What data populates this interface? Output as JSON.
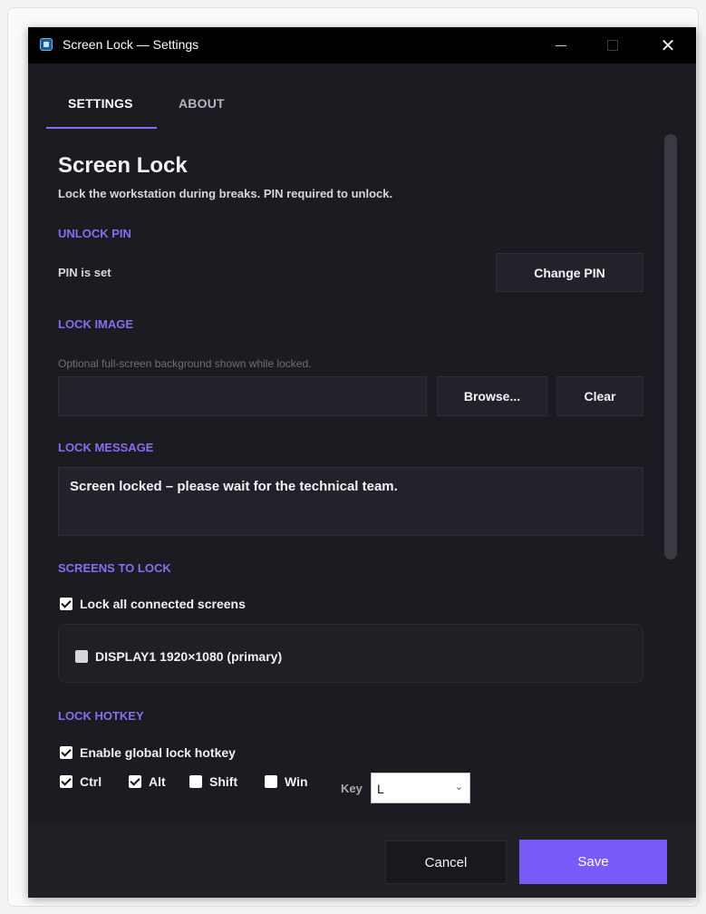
{
  "window": {
    "title": "Screen Lock — Settings"
  },
  "tabs": [
    {
      "label": "SETTINGS",
      "active": true
    },
    {
      "label": "ABOUT",
      "active": false
    }
  ],
  "page": {
    "heading": "Screen Lock",
    "subtitle": "Lock the workstation during breaks. PIN required to unlock."
  },
  "unlock_pin": {
    "section_label": "UNLOCK PIN",
    "status": "PIN is set",
    "change_button": "Change PIN"
  },
  "lock_image": {
    "section_label": "LOCK IMAGE",
    "hint": "Optional full-screen background shown while locked.",
    "path_value": "",
    "browse_button": "Browse...",
    "clear_button": "Clear"
  },
  "lock_message": {
    "section_label": "LOCK MESSAGE",
    "value": "Screen locked – please wait for the technical team."
  },
  "screens": {
    "section_label": "SCREENS TO LOCK",
    "lock_all_label": "Lock all connected screens",
    "lock_all_checked": true,
    "displays": [
      {
        "label": "DISPLAY1  1920×1080  (primary)",
        "checked": false
      }
    ]
  },
  "hotkey": {
    "section_label": "LOCK HOTKEY",
    "enable_label": "Enable global lock hotkey",
    "enable_checked": true,
    "modifiers": [
      {
        "label": "Ctrl",
        "checked": true
      },
      {
        "label": "Alt",
        "checked": true
      },
      {
        "label": "Shift",
        "checked": false
      },
      {
        "label": "Win",
        "checked": false
      }
    ],
    "key_label": "Key",
    "key_value": "L"
  },
  "footer": {
    "cancel_button": "Cancel",
    "save_button": "Save"
  },
  "colors": {
    "accent": "#8b6cf0",
    "save_button": "#7a5af8",
    "window_bg": "#1b1c21"
  }
}
